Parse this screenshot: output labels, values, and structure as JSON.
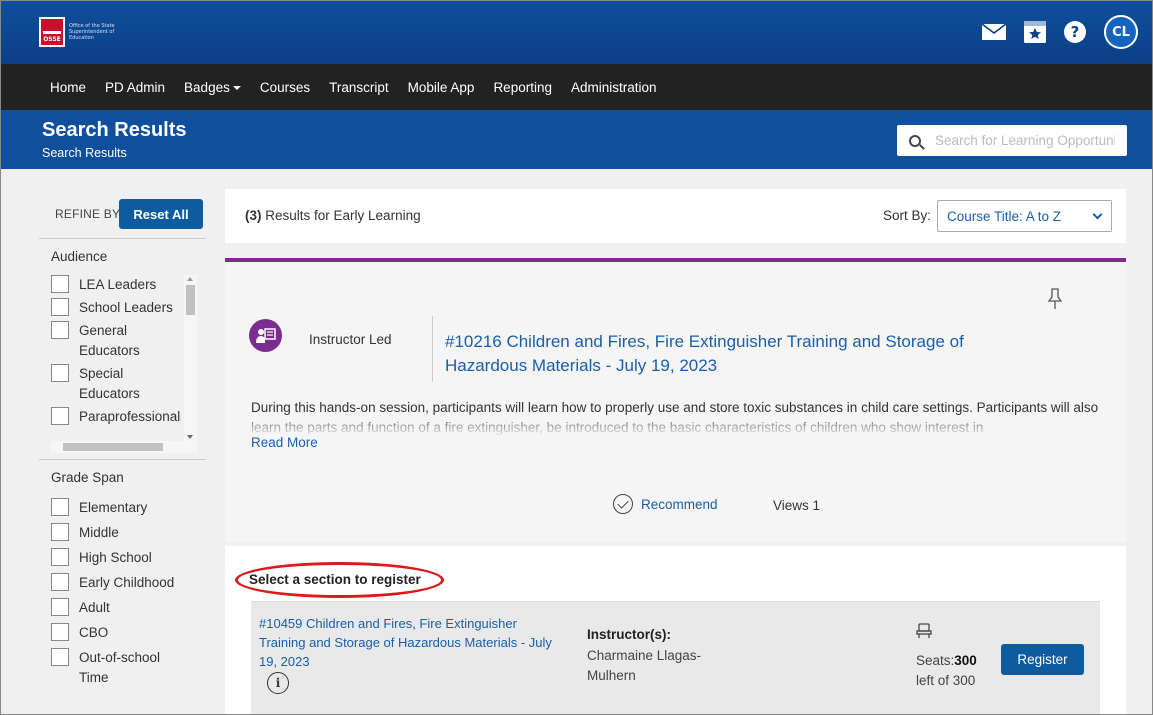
{
  "logo": {
    "org_text": "Office of the State Superintendent of Education",
    "abbr": "OSSE"
  },
  "user": {
    "initials": "CL"
  },
  "icons": {
    "mail": "mail-icon",
    "calendar": "calendar-star-icon",
    "help": "help-icon"
  },
  "nav": {
    "items": [
      {
        "label": "Home"
      },
      {
        "label": "PD Admin"
      },
      {
        "label": "Badges",
        "has_dropdown": true
      },
      {
        "label": "Courses"
      },
      {
        "label": "Transcript"
      },
      {
        "label": "Mobile App"
      },
      {
        "label": "Reporting"
      },
      {
        "label": "Administration"
      }
    ]
  },
  "header": {
    "title": "Search Results",
    "breadcrumb": "Search Results",
    "search_placeholder": "Search for Learning Opportunities"
  },
  "sidebar": {
    "refine_label": "REFINE BY",
    "reset_label": "Reset All",
    "audience_title": "Audience",
    "audience": [
      "LEA Leaders",
      "School Leaders",
      "General Educators",
      "Special Educators",
      "Paraprofessionals"
    ],
    "grade_title": "Grade Span",
    "grades": [
      "Elementary",
      "Middle",
      "High School",
      "Early Childhood",
      "Adult",
      "CBO",
      "Out-of-school Time"
    ]
  },
  "results": {
    "count": "(3)",
    "query_text": "Results for Early Learning",
    "sort_label": "Sort By:",
    "sort_value": "Course Title: A to Z"
  },
  "card": {
    "type_label": "Instructor Led",
    "title": "#10216 Children and Fires, Fire Extinguisher Training and Storage of Hazardous Materials - July 19, 2023",
    "description": "During this hands-on session, participants will learn how to properly use and store toxic substances in child care settings. Participants will also learn the parts and function of a fire extinguisher, be introduced to the basic characteristics of children who show interest in",
    "read_more": "Read More",
    "recommend": "Recommend",
    "views": "Views 1"
  },
  "section": {
    "heading": "Select a section to register",
    "title": "#10459 Children and Fires, Fire Extinguisher Training and Storage of Hazardous Materials - July 19, 2023",
    "instructor_label": "Instructor(s):",
    "instructor_name": "Charmaine Llagas-Mulhern",
    "seats_prefix": "Seats:",
    "seats_count": "300",
    "seats_suffix": "left of 300",
    "register_label": "Register"
  },
  "colors": {
    "brand_blue": "#0f4f9c",
    "nav_dark": "#222222",
    "link_blue": "#1a5fa8",
    "accent_purple": "#7b2c8f",
    "annotation_red": "#d91a1a"
  }
}
